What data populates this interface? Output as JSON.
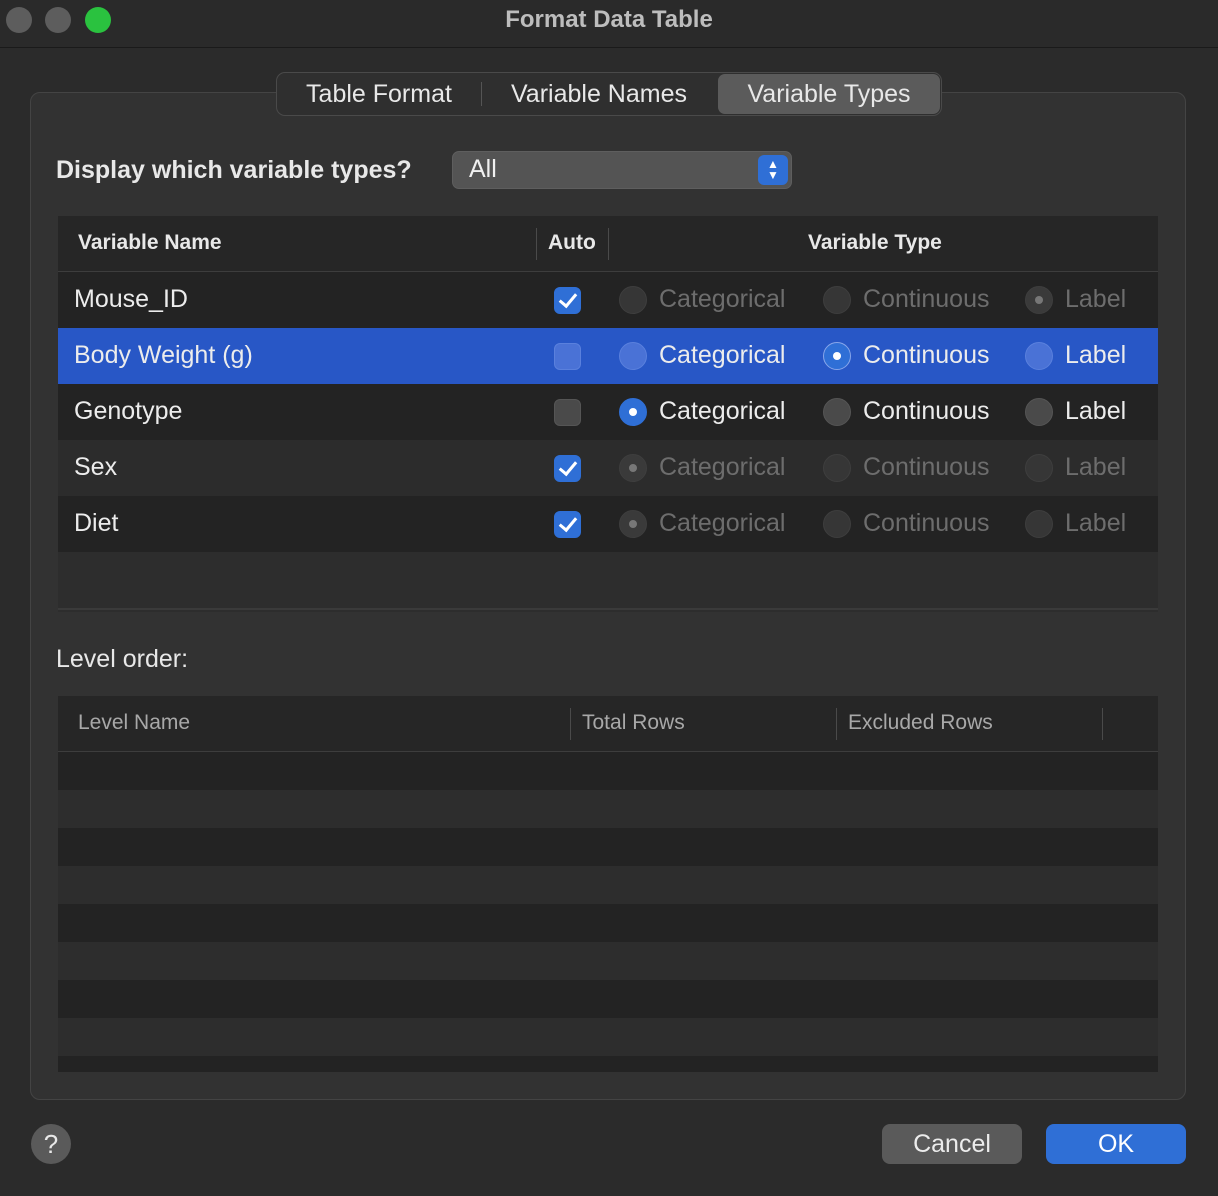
{
  "window": {
    "title": "Format Data Table"
  },
  "tabs": [
    {
      "label": "Table Format"
    },
    {
      "label": "Variable Names"
    },
    {
      "label": "Variable Types",
      "active": true
    }
  ],
  "filter": {
    "label": "Display which variable types?",
    "value": "All"
  },
  "variable_table": {
    "columns": {
      "name": "Variable Name",
      "auto": "Auto",
      "type": "Variable Type"
    },
    "type_options": [
      "Categorical",
      "Continuous",
      "Label"
    ],
    "rows": [
      {
        "name": "Mouse_ID",
        "auto": true,
        "type": "Label",
        "selected": false
      },
      {
        "name": "Body Weight (g)",
        "auto": false,
        "type": "Continuous",
        "selected": true
      },
      {
        "name": "Genotype",
        "auto": false,
        "type": "Categorical",
        "selected": false
      },
      {
        "name": "Sex",
        "auto": true,
        "type": "Categorical",
        "selected": false
      },
      {
        "name": "Diet",
        "auto": true,
        "type": "Categorical",
        "selected": false
      }
    ]
  },
  "level_order": {
    "label": "Level order:",
    "columns": {
      "level_name": "Level Name",
      "total_rows": "Total Rows",
      "excluded_rows": "Excluded Rows"
    }
  },
  "footer": {
    "help": "?",
    "cancel": "Cancel",
    "ok": "OK"
  },
  "colors": {
    "accent": "#2f6fd6",
    "selection": "#2857c6",
    "close_max": "#2ac23f"
  }
}
